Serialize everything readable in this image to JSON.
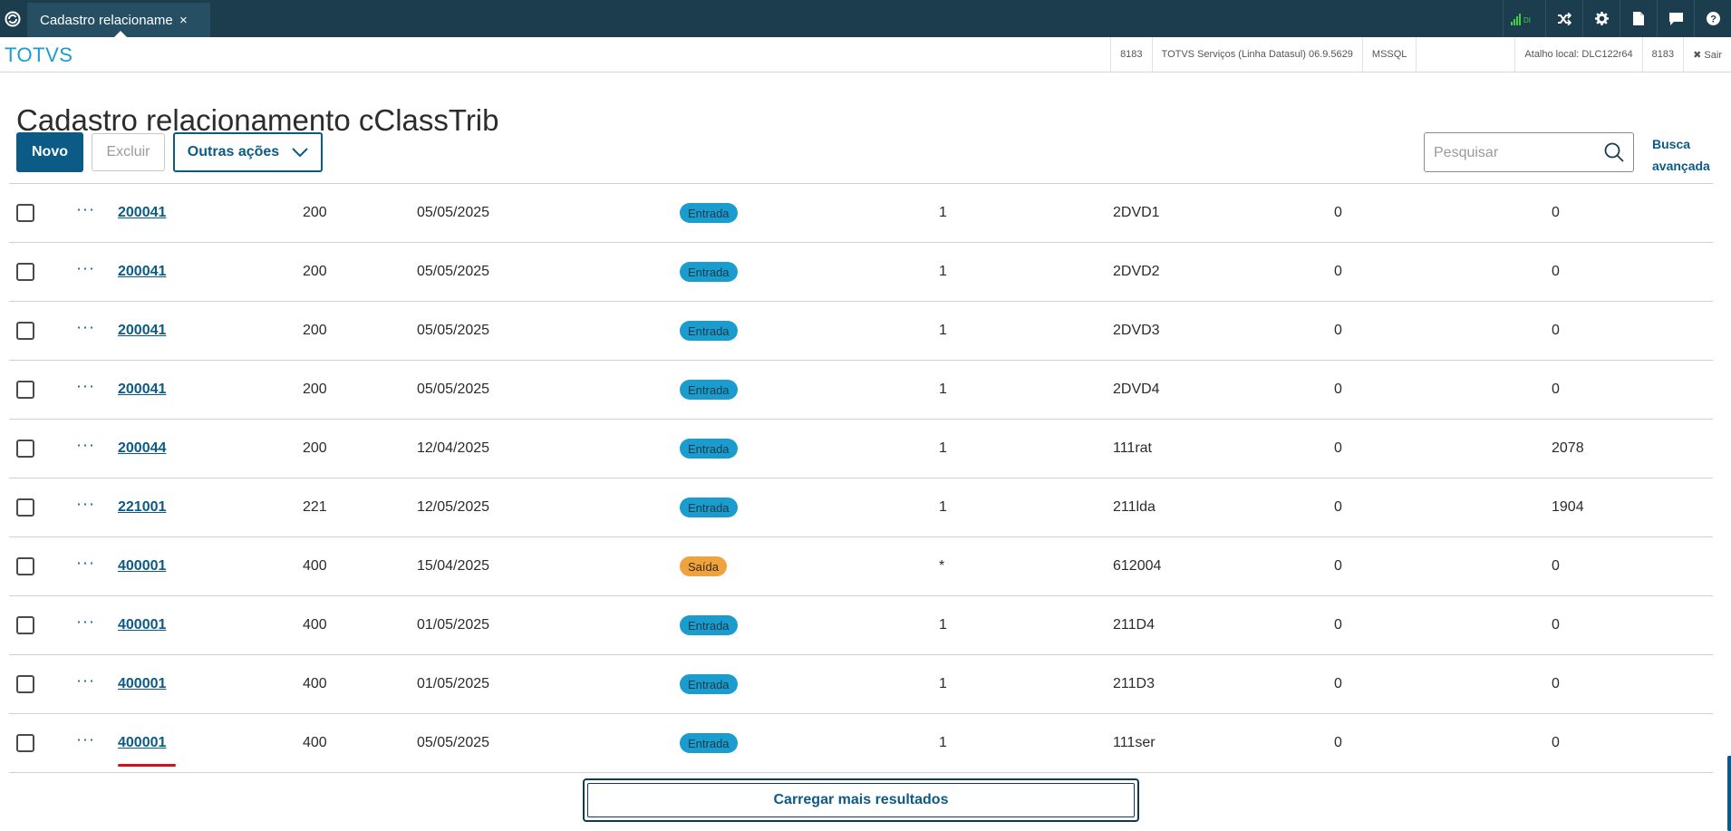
{
  "topbar": {
    "tab_label": "Cadastro relacionament",
    "tab_close": "×",
    "signal_text": "DI"
  },
  "header": {
    "brand": "TOTVS",
    "info": [
      "8183",
      "TOTVS Serviços (Linha Datasul) 06.9.5629",
      "MSSQL",
      "",
      "Atalho local: DLC122r64",
      "8183"
    ],
    "exit_label": "✖ Sair"
  },
  "page": {
    "title": "Cadastro relacionamento cClassTrib"
  },
  "actions": {
    "novo": "Novo",
    "excluir": "Excluir",
    "outras": "Outras ações"
  },
  "search": {
    "placeholder": "Pesquisar",
    "value": ""
  },
  "busca_avancada": {
    "line1": "Busca",
    "line2": "avançada"
  },
  "rows": [
    {
      "code": "200041",
      "c2": "200",
      "date": "05/05/2025",
      "status": "Entrada",
      "c5": "1",
      "c6": "2DVD1",
      "c7": "0",
      "c8": "0"
    },
    {
      "code": "200041",
      "c2": "200",
      "date": "05/05/2025",
      "status": "Entrada",
      "c5": "1",
      "c6": "2DVD2",
      "c7": "0",
      "c8": "0"
    },
    {
      "code": "200041",
      "c2": "200",
      "date": "05/05/2025",
      "status": "Entrada",
      "c5": "1",
      "c6": "2DVD3",
      "c7": "0",
      "c8": "0"
    },
    {
      "code": "200041",
      "c2": "200",
      "date": "05/05/2025",
      "status": "Entrada",
      "c5": "1",
      "c6": "2DVD4",
      "c7": "0",
      "c8": "0"
    },
    {
      "code": "200044",
      "c2": "200",
      "date": "12/04/2025",
      "status": "Entrada",
      "c5": "1",
      "c6": "111rat",
      "c7": "0",
      "c8": "2078"
    },
    {
      "code": "221001",
      "c2": "221",
      "date": "12/05/2025",
      "status": "Entrada",
      "c5": "1",
      "c6": "211lda",
      "c7": "0",
      "c8": "1904"
    },
    {
      "code": "400001",
      "c2": "400",
      "date": "15/04/2025",
      "status": "Saída",
      "c5": "*",
      "c6": "612004",
      "c7": "0",
      "c8": "0"
    },
    {
      "code": "400001",
      "c2": "400",
      "date": "01/05/2025",
      "status": "Entrada",
      "c5": "1",
      "c6": "211D4",
      "c7": "0",
      "c8": "0"
    },
    {
      "code": "400001",
      "c2": "400",
      "date": "01/05/2025",
      "status": "Entrada",
      "c5": "1",
      "c6": "211D3",
      "c7": "0",
      "c8": "0"
    },
    {
      "code": "400001",
      "c2": "400",
      "date": "05/05/2025",
      "status": "Entrada",
      "c5": "1",
      "c6": "111ser",
      "c7": "0",
      "c8": "0"
    }
  ],
  "more_label": "···",
  "load_more": "Carregar mais resultados",
  "colors": {
    "topbar": "#1c3d4e",
    "primary": "#0c5a86",
    "brand": "#1a9ccf",
    "entrada": "#1a9ccf",
    "saida": "#f0a23e",
    "annotation": "#d30f1e"
  }
}
